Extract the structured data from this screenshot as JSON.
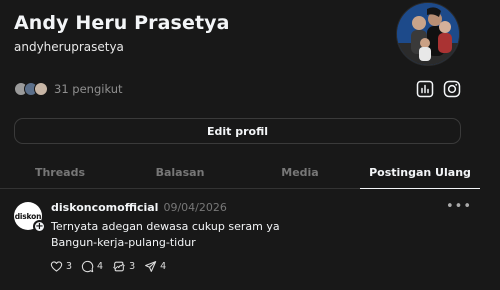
{
  "profile": {
    "name": "Andy Heru Prasetya",
    "handle": "andyheruprasetya",
    "followers_text": "31 pengikut",
    "edit_label": "Edit profil"
  },
  "icons": {
    "insights": "bar-chart-icon",
    "instagram": "instagram-icon"
  },
  "tabs": [
    {
      "label": "Threads",
      "active": false
    },
    {
      "label": "Balasan",
      "active": false
    },
    {
      "label": "Media",
      "active": false
    },
    {
      "label": "Postingan Ulang",
      "active": true
    }
  ],
  "post": {
    "avatar_text_main": "diskon",
    "avatar_text_accent": "",
    "username": "diskoncomofficial",
    "date": "09/04/2026",
    "text": "Ternyata adegan dewasa cukup seram ya\nBangun-kerja-pulang-tidur",
    "more_glyph": "•••",
    "likes": "3",
    "replies": "4",
    "reposts": "3",
    "shares": "4"
  },
  "colors": {
    "background": "#181818",
    "text": "#f3f5f7",
    "muted": "#777777",
    "border": "#3a3a3a"
  }
}
